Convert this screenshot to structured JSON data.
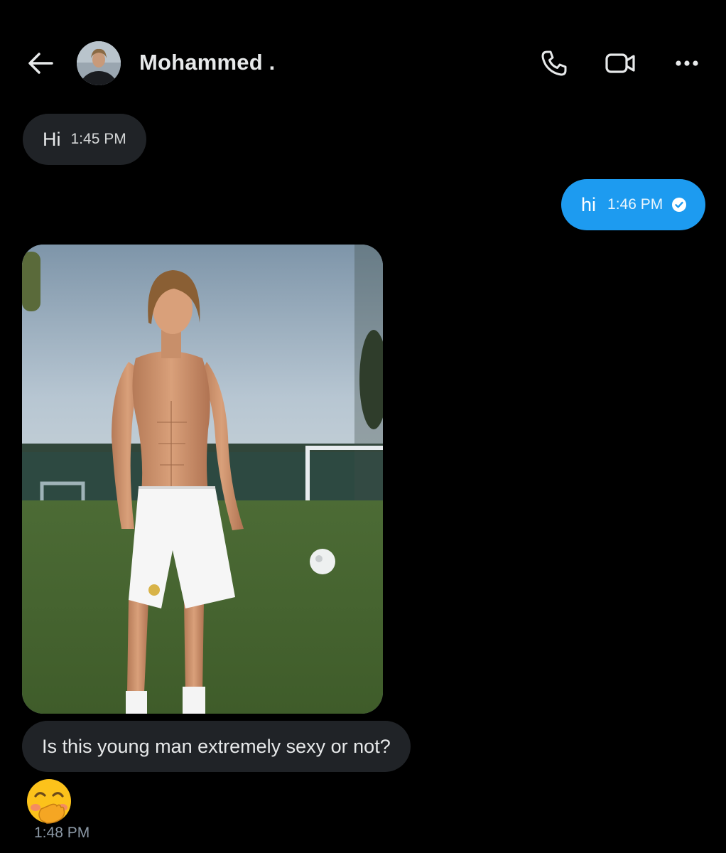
{
  "header": {
    "contact_name": "Mohammed .",
    "back_icon": "back-arrow-icon",
    "call_icon": "phone-icon",
    "video_icon": "video-camera-icon",
    "more_icon": "more-dots-icon"
  },
  "messages": [
    {
      "direction": "incoming",
      "text": "Hi",
      "time": "1:45 PM"
    },
    {
      "direction": "outgoing",
      "text": "hi",
      "time": "1:46 PM",
      "status_icon": "read-check-icon"
    },
    {
      "direction": "incoming",
      "type": "image",
      "subject": "shirtless footballer standing on a grass training pitch"
    },
    {
      "direction": "incoming",
      "text": "Is this young man extremely sexy or not?"
    },
    {
      "direction": "incoming",
      "type": "emoji",
      "emoji": "🤭",
      "time": "1:48 PM"
    }
  ],
  "colors": {
    "background": "#000000",
    "incoming_bubble": "#202327",
    "outgoing_bubble": "#1d9bf0",
    "text": "#e7e9ea",
    "muted": "#8b98a5"
  }
}
